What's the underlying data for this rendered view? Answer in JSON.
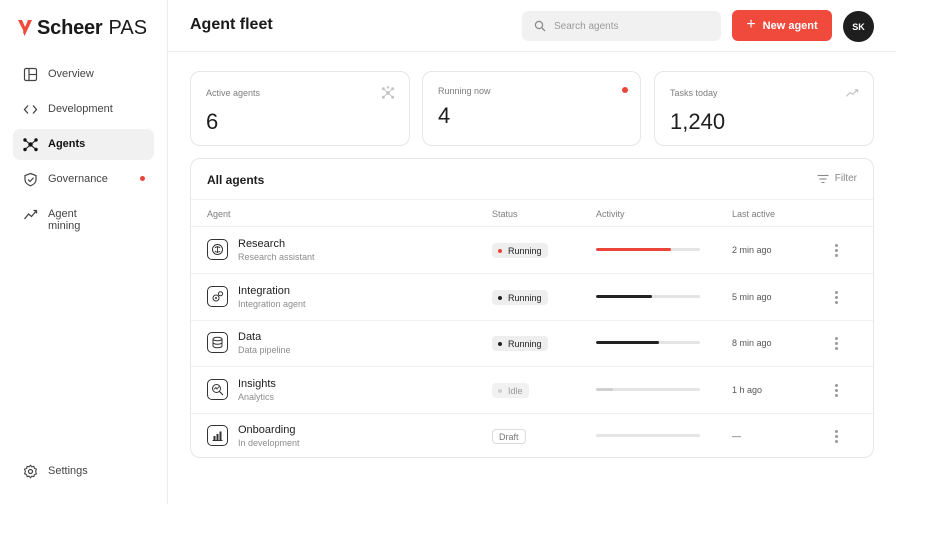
{
  "brand": {
    "name": "Scheer",
    "product": "PAS",
    "accent": "#f04a3c"
  },
  "sidebar": {
    "items": [
      {
        "label": "Overview",
        "icon": "layout-icon",
        "active": false
      },
      {
        "label": "Development",
        "icon": "code-icon",
        "active": false
      },
      {
        "label": "Agents",
        "icon": "agents-icon",
        "active": true
      },
      {
        "label": "Governance",
        "icon": "shield-icon",
        "active": false,
        "notification": true
      },
      {
        "label": "Agent mining",
        "icon": "trend-icon",
        "active": false
      }
    ],
    "settings_label": "Settings"
  },
  "header": {
    "title": "Agent fleet",
    "search_placeholder": "Search agents",
    "new_button_label": "New agent",
    "avatar_initials": "SK"
  },
  "stats": [
    {
      "label": "Active agents",
      "value": "6",
      "icon": "agents-icon"
    },
    {
      "label": "Running now",
      "value": "4",
      "icon": "live-dot"
    },
    {
      "label": "Tasks today",
      "value": "1,240",
      "icon": "trend-icon"
    }
  ],
  "table": {
    "title": "All agents",
    "filter_label": "Filter",
    "columns": [
      "Agent",
      "Status",
      "Activity",
      "Last active"
    ],
    "rows": [
      {
        "name": "Research",
        "subtitle": "Research assistant",
        "icon": "brain-icon",
        "status": "Running",
        "status_kind": "running",
        "status_dot_color": "#e9453a",
        "activity": 0.72,
        "activity_color": "#e9453a",
        "last_active": "2 min ago"
      },
      {
        "name": "Integration",
        "subtitle": "Integration agent",
        "icon": "gears-icon",
        "status": "Running",
        "status_kind": "running",
        "status_dot_color": "#222222",
        "activity": 0.54,
        "activity_color": "#222222",
        "last_active": "5 min ago"
      },
      {
        "name": "Data",
        "subtitle": "Data pipeline",
        "icon": "database-icon",
        "status": "Running",
        "status_kind": "running",
        "status_dot_color": "#222222",
        "activity": 0.61,
        "activity_color": "#222222",
        "last_active": "8 min ago"
      },
      {
        "name": "Insights",
        "subtitle": "Analytics",
        "icon": "analytics-icon",
        "status": "Idle",
        "status_kind": "idle",
        "status_dot_color": "#cfcfcf",
        "activity": 0.16,
        "activity_color": "#cfcfcf",
        "last_active": "1 h ago"
      },
      {
        "name": "Onboarding",
        "subtitle": "In development",
        "icon": "bar-chart-icon",
        "status": "Draft",
        "status_kind": "draft",
        "status_dot_color": "",
        "activity": 0,
        "activity_color": "#e4e4e4",
        "last_active": "—"
      }
    ]
  }
}
